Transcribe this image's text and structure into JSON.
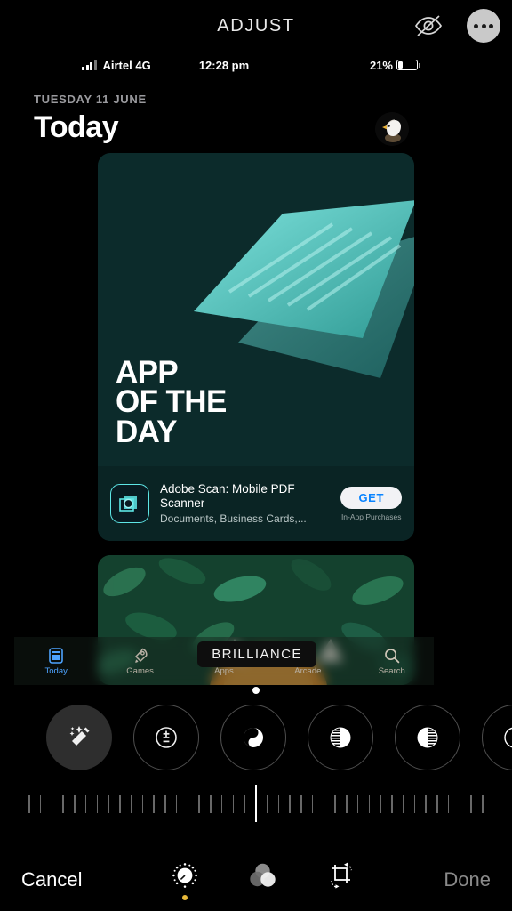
{
  "topbar": {
    "title": "ADJUST",
    "hide_icon": "eye-slash-icon",
    "more_icon": "ellipsis-icon"
  },
  "photo": {
    "statusbar": {
      "carrier": "Airtel 4G",
      "time": "12:28 pm",
      "battery_percent": "21%",
      "signal_icon": "cellular-bars-icon",
      "battery_icon": "battery-low-icon"
    },
    "today": {
      "date": "TUESDAY 11 JUNE",
      "title": "Today",
      "avatar": "eagle-avatar"
    },
    "card1": {
      "eyebrow": "APP OF THE DAY",
      "headline_lines": [
        "APP",
        "OF THE",
        "DAY"
      ],
      "app_icon": "adobe-scan-icon",
      "app_name": "Adobe Scan: Mobile PDF Scanner",
      "app_subtitle": "Documents, Business Cards,...",
      "get_label": "GET",
      "iap_note": "In-App Purchases",
      "bg_color": "#0c2b2b",
      "accent_color": "#5ee6e6"
    },
    "tabbar": {
      "items": [
        {
          "label": "Today",
          "icon": "today-card-icon",
          "active": true
        },
        {
          "label": "Games",
          "icon": "rocket-icon",
          "active": false
        },
        {
          "label": "Apps",
          "icon": "apps-stack-icon",
          "active": false
        },
        {
          "label": "Arcade",
          "icon": "joystick-icon",
          "active": false
        },
        {
          "label": "Search",
          "icon": "magnifier-icon",
          "active": false
        }
      ],
      "active_color": "#4da3ff"
    }
  },
  "tooltip": {
    "label": "BRILLIANCE"
  },
  "filters": {
    "items": [
      {
        "name": "auto-enhance",
        "icon": "magic-wand-icon",
        "selected": true
      },
      {
        "name": "exposure",
        "icon": "plus-minus-circle-icon",
        "selected": false
      },
      {
        "name": "brilliance",
        "icon": "brilliance-icon",
        "selected": false
      },
      {
        "name": "highlights",
        "icon": "highlights-icon",
        "selected": false
      },
      {
        "name": "shadows",
        "icon": "shadows-icon",
        "selected": false
      },
      {
        "name": "contrast",
        "icon": "contrast-icon",
        "selected": false
      }
    ]
  },
  "slider": {
    "value_position_percent": 50,
    "tick_count": 41
  },
  "bottombar": {
    "cancel_label": "Cancel",
    "done_label": "Done",
    "tools": [
      {
        "name": "adjust",
        "icon": "dial-icon",
        "active": true
      },
      {
        "name": "filters",
        "icon": "three-circles-icon",
        "active": false
      },
      {
        "name": "crop",
        "icon": "crop-rotate-icon",
        "active": false
      }
    ],
    "active_dot_color": "#e8b93a"
  }
}
